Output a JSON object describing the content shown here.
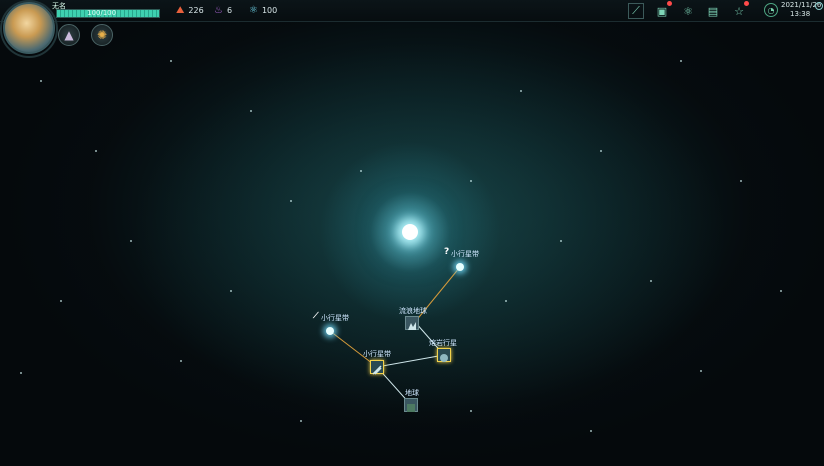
{
  "player": {
    "name": "无名",
    "hp_text": "100/100",
    "hp_fraction": 1.0
  },
  "skills": [
    {
      "icon": "wizard-hat-icon"
    },
    {
      "icon": "sun-wheel-icon"
    }
  ],
  "resources": [
    {
      "icon": "fire-triangle-icon",
      "glyph": "⛰",
      "color": "#e8603c",
      "value": "226"
    },
    {
      "icon": "purple-flame-icon",
      "glyph": "♨",
      "color": "#b66be0",
      "value": "6"
    },
    {
      "icon": "atom-icon",
      "glyph": "⚛",
      "color": "#6fd3e8",
      "value": "100"
    }
  ],
  "toolbar": [
    {
      "icon": "chart-icon",
      "glyph": "⟋"
    },
    {
      "icon": "card-icon",
      "glyph": "▣",
      "badge": true
    },
    {
      "icon": "atom-settings-icon",
      "glyph": "⚛"
    },
    {
      "icon": "scroll-icon",
      "glyph": "▤"
    },
    {
      "icon": "star-icon",
      "glyph": "☆",
      "badge": true
    }
  ],
  "clock": {
    "date": "2021/11/26",
    "time": "13:38"
  },
  "map": {
    "nodes": [
      {
        "id": "asteroid-belt-ne",
        "label": "小行星带",
        "type": "unknown"
      },
      {
        "id": "wandering-earth",
        "label": "流浪地球",
        "type": "tile"
      },
      {
        "id": "lava-planet",
        "label": "熔岩行星",
        "type": "tile-selected"
      },
      {
        "id": "asteroid-belt-w",
        "label": "小行星带",
        "type": "sword"
      },
      {
        "id": "asteroid-belt-center",
        "label": "小行星带",
        "type": "tile-selected"
      },
      {
        "id": "earth",
        "label": "地球",
        "type": "tile"
      }
    ],
    "unknown_marker": "?",
    "sword_marker": "⟋",
    "colors": {
      "orange_route": "#d59a3a",
      "white_route": "#cfe6ea",
      "selected_border": "#f2d24c"
    }
  }
}
